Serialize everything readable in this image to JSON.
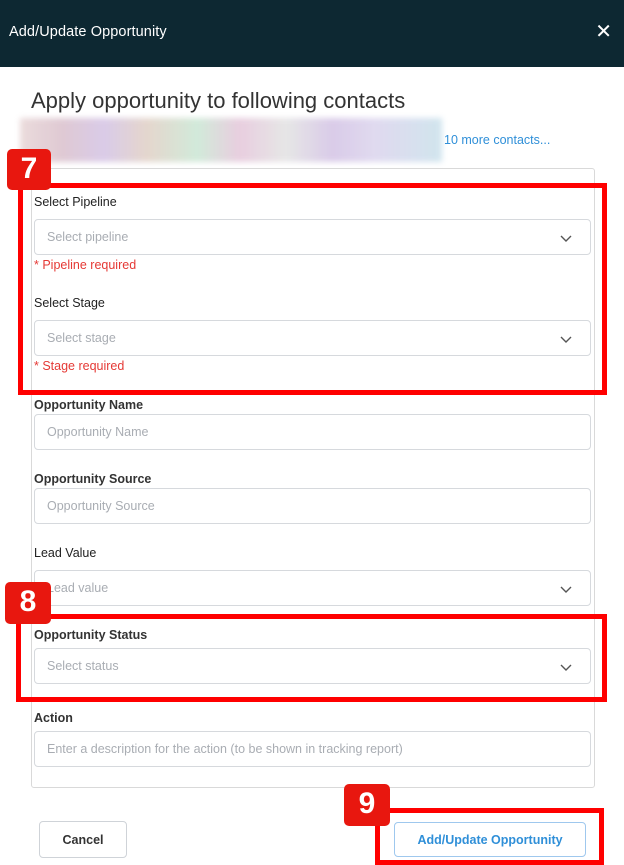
{
  "dialog": {
    "title": "Add/Update Opportunity",
    "close_symbol": "✕"
  },
  "contacts": {
    "heading": "Apply opportunity to following contacts",
    "more_link": "10 more contacts..."
  },
  "form": {
    "pipeline": {
      "label": "Select Pipeline",
      "placeholder": "Select pipeline",
      "error": "* Pipeline required"
    },
    "stage": {
      "label": "Select Stage",
      "placeholder": "Select stage",
      "error": "* Stage required"
    },
    "opportunity_name": {
      "label": "Opportunity Name",
      "placeholder": "Opportunity Name"
    },
    "opportunity_source": {
      "label": "Opportunity Source",
      "placeholder": "Opportunity Source"
    },
    "lead_value": {
      "label": "Lead Value",
      "placeholder": "Lead value"
    },
    "opportunity_status": {
      "label": "Opportunity Status",
      "placeholder": "Select status"
    },
    "action": {
      "label": "Action",
      "placeholder": "Enter a description for the action (to be shown in tracking report)"
    }
  },
  "buttons": {
    "cancel": "Cancel",
    "submit": "Add/Update Opportunity"
  },
  "annotations": {
    "badge_7": "7",
    "badge_8": "8",
    "badge_9": "9",
    "highlight_color": "#ff0000"
  }
}
